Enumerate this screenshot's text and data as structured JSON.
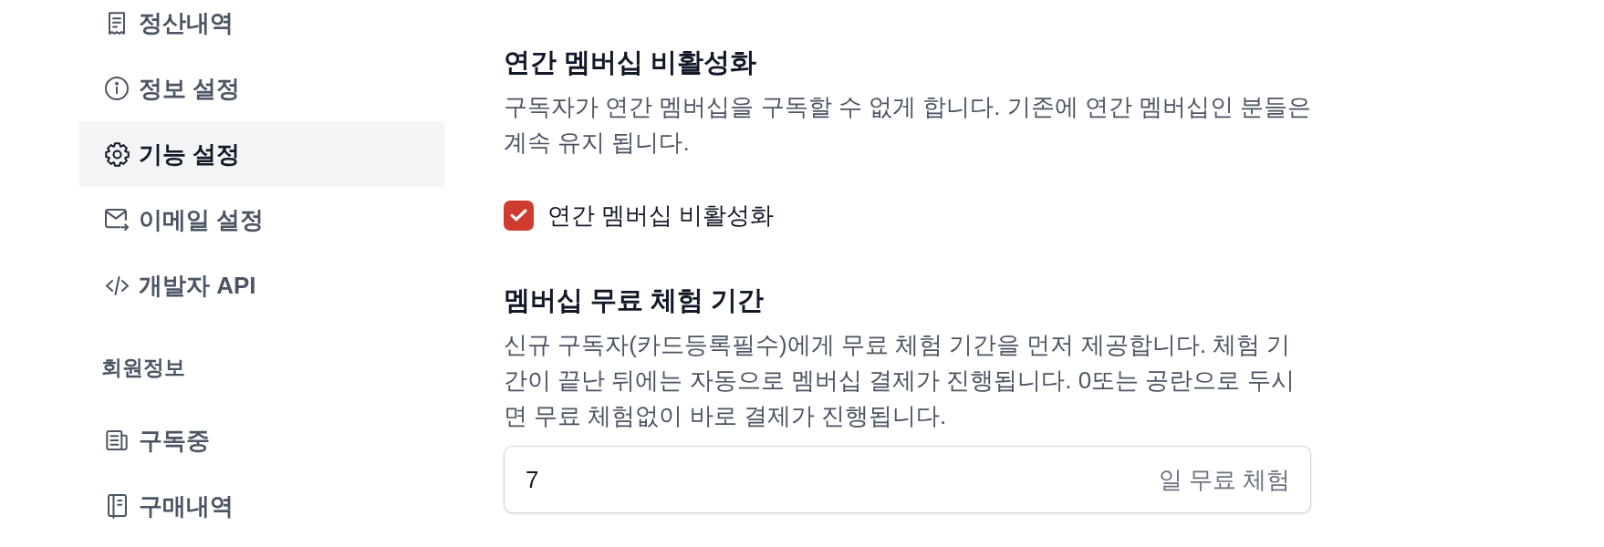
{
  "sidebar": {
    "groups": [
      {
        "items": [
          {
            "label": "정산내역",
            "selected": false
          },
          {
            "label": "정보 설정",
            "selected": false
          },
          {
            "label": "기능 설정",
            "selected": true
          },
          {
            "label": "이메일 설정",
            "selected": false
          },
          {
            "label": "개발자 API",
            "selected": false
          }
        ]
      },
      {
        "title": "회원정보",
        "items": [
          {
            "label": "구독중",
            "selected": false
          },
          {
            "label": "구매내역",
            "selected": false
          }
        ]
      }
    ]
  },
  "settings": [
    {
      "kind": "checkbox",
      "title": "연간 멤버십 비활성화",
      "description": "구독자가 연간 멤버십을 구독할 수 없게 합니다. 기존에 연간 멤버십인 분들은 계속 유지 됩니다.",
      "checkbox": {
        "label": "연간 멤버십 비활성화",
        "checked": true
      }
    },
    {
      "kind": "number",
      "title": "멤버십 무료 체험 기간",
      "description": "신규 구독자(카드등록필수)에게 무료 체험 기간을 먼저 제공합니다. 체험 기간이 끝난 뒤에는 자동으로 멤버십 결제가 진행됩니다. 0또는 공란으로 두시면 무료 체험없이 바로 결제가 진행됩니다.",
      "field": {
        "value": "7",
        "suffix": "일 무료 체험"
      }
    }
  ]
}
